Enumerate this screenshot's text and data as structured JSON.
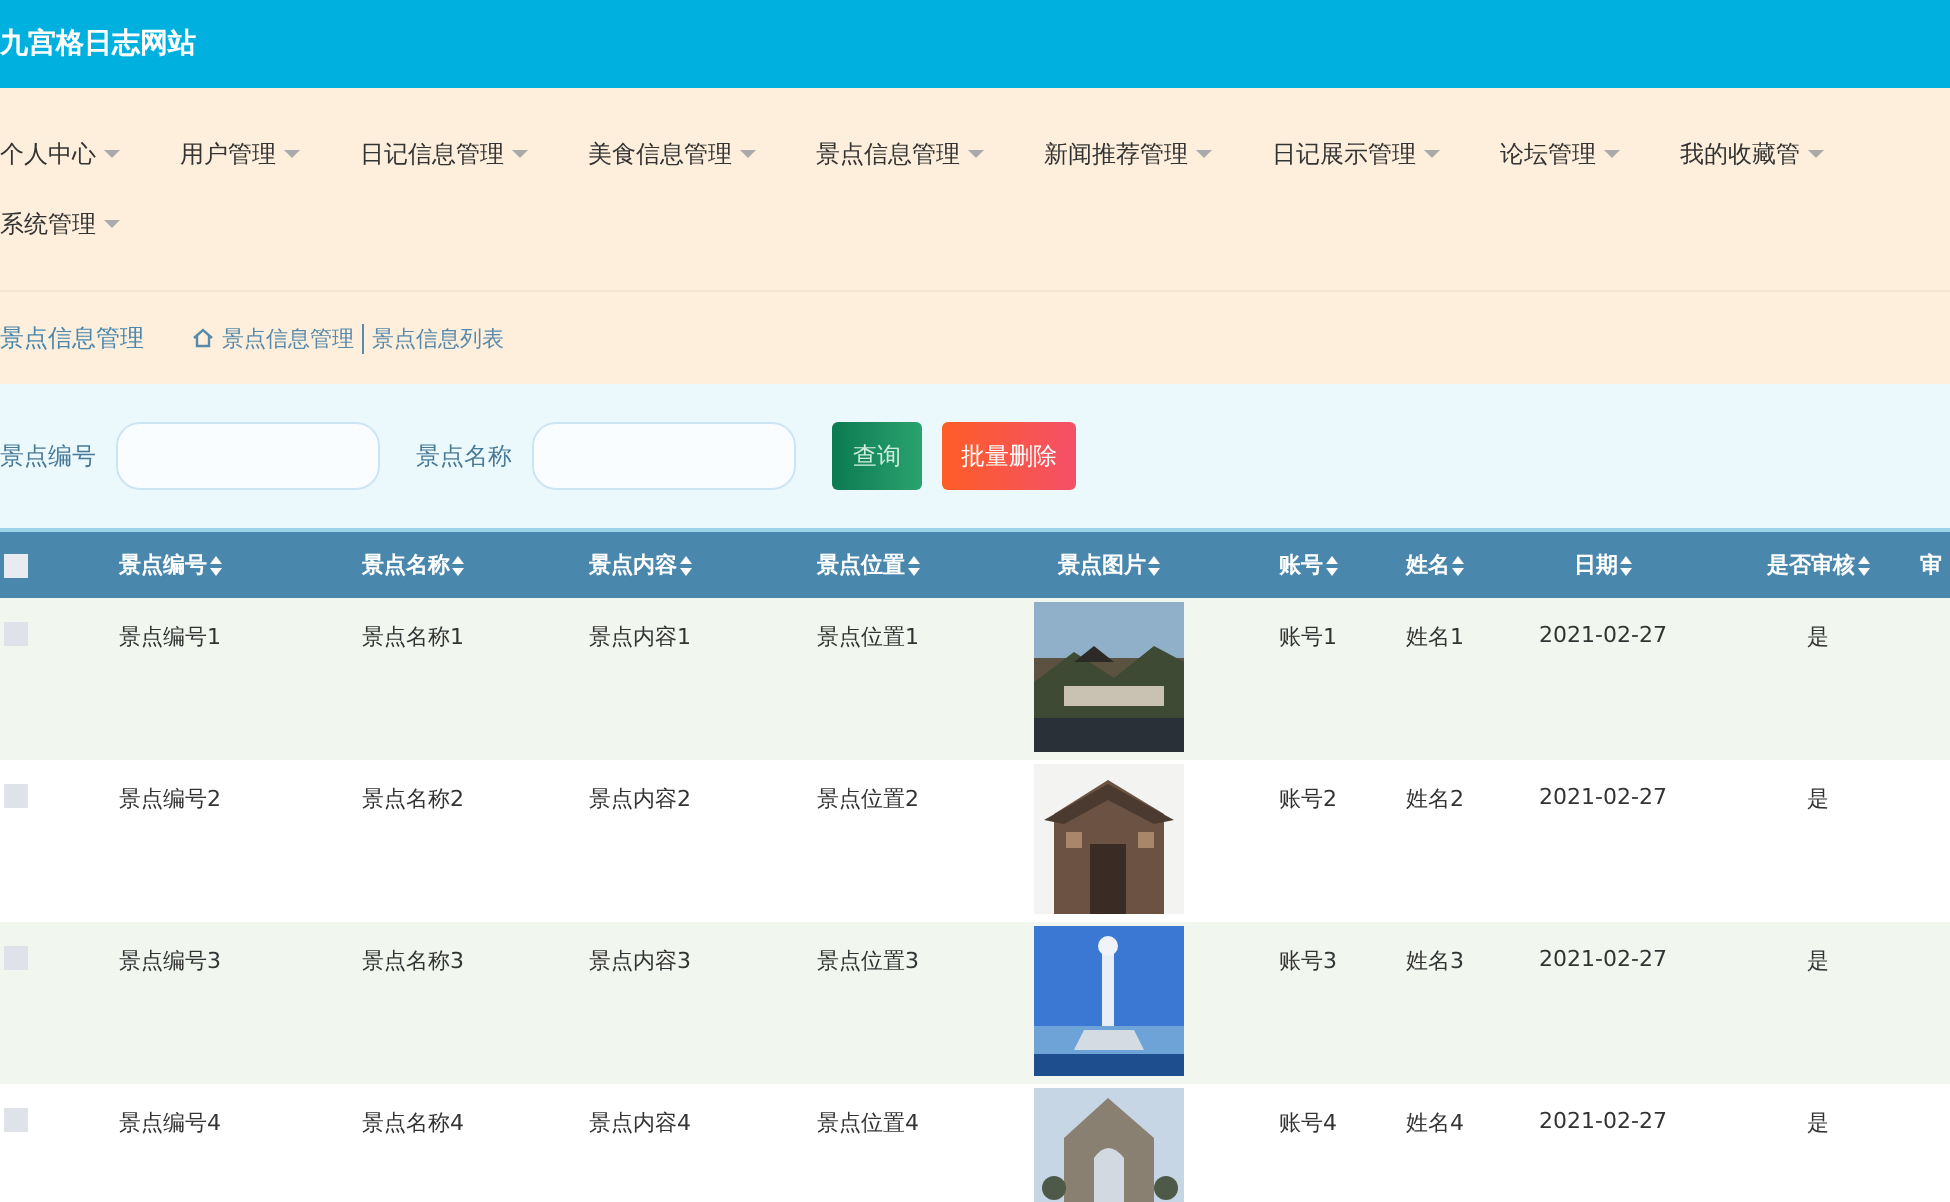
{
  "site_title": "九宫格日志网站",
  "nav": [
    {
      "label": "个人中心"
    },
    {
      "label": "用户管理"
    },
    {
      "label": "日记信息管理"
    },
    {
      "label": "美食信息管理"
    },
    {
      "label": "景点信息管理"
    },
    {
      "label": "新闻推荐管理"
    },
    {
      "label": "日记展示管理"
    },
    {
      "label": "论坛管理"
    },
    {
      "label": "我的收藏管"
    },
    {
      "label": "系统管理"
    }
  ],
  "breadcrumb": {
    "title": "景点信息管理",
    "path": [
      "景点信息管理",
      "景点信息列表"
    ]
  },
  "search": {
    "fields": [
      {
        "label": "景点编号"
      },
      {
        "label": "景点名称"
      }
    ],
    "buttons": [
      {
        "label": "查询",
        "kind": "search"
      },
      {
        "label": "批量删除",
        "kind": "delete"
      }
    ]
  },
  "table": {
    "select_all_checked": false,
    "columns": [
      "景点编号",
      "景点名称",
      "景点内容",
      "景点位置",
      "景点图片",
      "账号",
      "姓名",
      "日期",
      "是否审核",
      "审"
    ],
    "rows": [
      {
        "checked": false,
        "cells": [
          "景点编号1",
          "景点名称1",
          "景点内容1",
          "景点位置1",
          "",
          "账号1",
          "姓名1",
          "2021-02-27",
          "是",
          ""
        ]
      },
      {
        "checked": false,
        "cells": [
          "景点编号2",
          "景点名称2",
          "景点内容2",
          "景点位置2",
          "",
          "账号2",
          "姓名2",
          "2021-02-27",
          "是",
          ""
        ]
      },
      {
        "checked": false,
        "cells": [
          "景点编号3",
          "景点名称3",
          "景点内容3",
          "景点位置3",
          "",
          "账号3",
          "姓名3",
          "2021-02-27",
          "是",
          ""
        ]
      },
      {
        "checked": false,
        "cells": [
          "景点编号4",
          "景点名称4",
          "景点内容4",
          "景点位置4",
          "",
          "账号4",
          "姓名4",
          "2021-02-27",
          "是",
          ""
        ]
      }
    ]
  }
}
